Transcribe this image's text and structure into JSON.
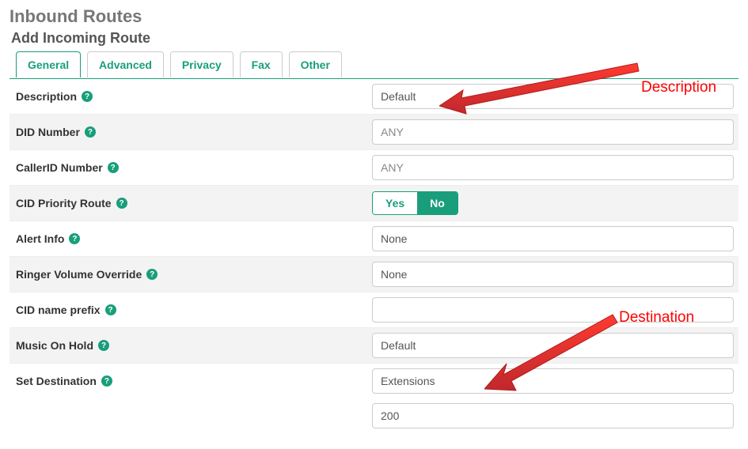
{
  "page": {
    "title": "Inbound Routes",
    "subtitle": "Add Incoming Route"
  },
  "tabs": [
    {
      "label": "General",
      "active": true
    },
    {
      "label": "Advanced",
      "active": false
    },
    {
      "label": "Privacy",
      "active": false
    },
    {
      "label": "Fax",
      "active": false
    },
    {
      "label": "Other",
      "active": false
    }
  ],
  "form": {
    "description": {
      "label": "Description",
      "value": "Default"
    },
    "did_number": {
      "label": "DID Number",
      "placeholder": "ANY",
      "value": ""
    },
    "callerid_number": {
      "label": "CallerID Number",
      "placeholder": "ANY",
      "value": ""
    },
    "cid_priority": {
      "label": "CID Priority Route",
      "yes": "Yes",
      "no": "No",
      "value": "No"
    },
    "alert_info": {
      "label": "Alert Info",
      "value": "None"
    },
    "ringer_override": {
      "label": "Ringer Volume Override",
      "value": "None"
    },
    "cid_prefix": {
      "label": "CID name prefix",
      "value": ""
    },
    "moh": {
      "label": "Music On Hold",
      "value": "Default"
    },
    "destination": {
      "label": "Set Destination",
      "module": "Extensions",
      "target": "200"
    }
  },
  "help_glyph": "?",
  "annotations": {
    "description": "Description",
    "destination": "Destination"
  }
}
